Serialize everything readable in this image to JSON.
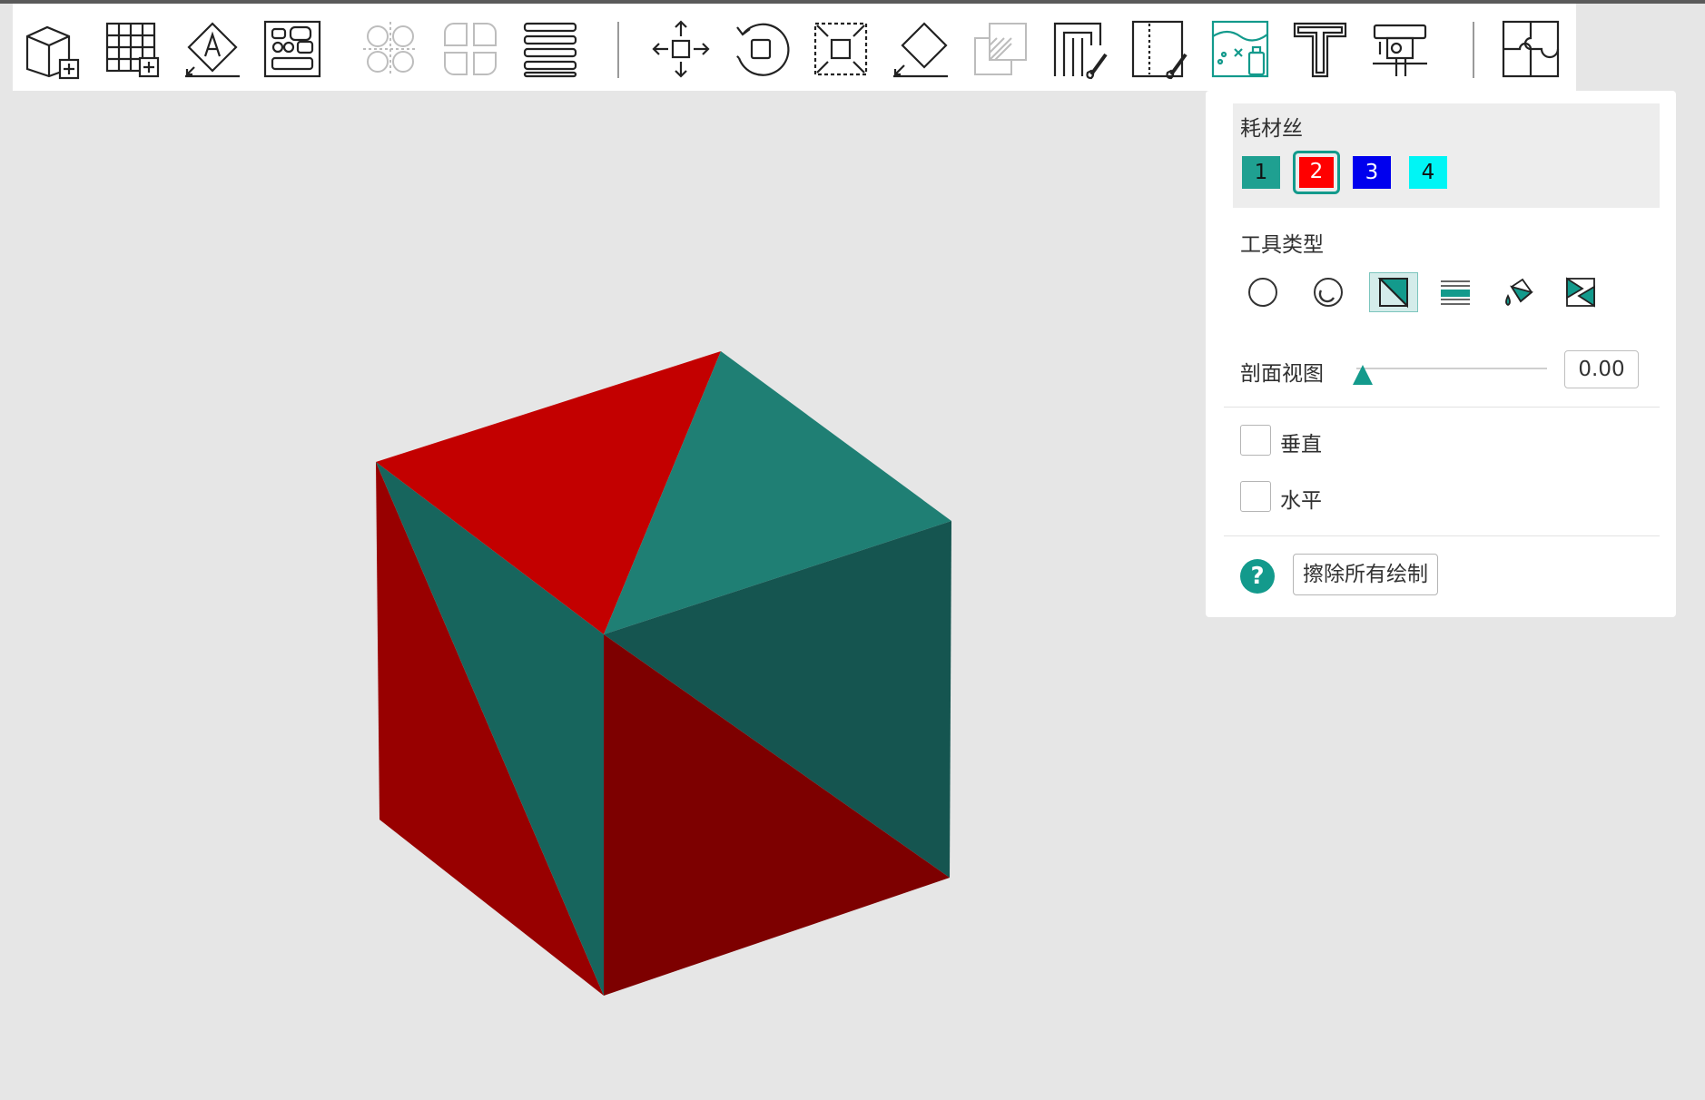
{
  "toolbar": {
    "buttons": [
      {
        "name": "add-model-icon",
        "enabled": true
      },
      {
        "name": "add-grid-plate-icon",
        "enabled": true
      },
      {
        "name": "auto-orient-icon",
        "enabled": true
      },
      {
        "name": "arrange-icon",
        "enabled": true
      },
      {
        "name": "split-objects-icon",
        "enabled": false
      },
      {
        "name": "split-parts-icon",
        "enabled": false
      },
      {
        "name": "layers-icon",
        "enabled": true
      },
      {
        "name": "move-icon",
        "enabled": true
      },
      {
        "name": "rotate-icon",
        "enabled": true
      },
      {
        "name": "scale-icon",
        "enabled": true
      },
      {
        "name": "lay-on-face-icon",
        "enabled": true
      },
      {
        "name": "cut-icon",
        "enabled": false
      },
      {
        "name": "support-paint-icon",
        "enabled": true
      },
      {
        "name": "seam-paint-icon",
        "enabled": true
      },
      {
        "name": "color-paint-icon",
        "enabled": true,
        "active": true
      },
      {
        "name": "text-icon",
        "enabled": true
      },
      {
        "name": "measure-icon",
        "enabled": true
      },
      {
        "name": "assembly-icon",
        "enabled": true
      }
    ]
  },
  "panel": {
    "filament_label": "耗材丝",
    "filaments": [
      {
        "label": "1",
        "color": "#1fa091"
      },
      {
        "label": "2",
        "color": "#ff0000",
        "selected": true
      },
      {
        "label": "3",
        "color": "#0000ee"
      },
      {
        "label": "4",
        "color": "#00f5f5"
      }
    ],
    "tool_type_label": "工具类型",
    "tools": [
      {
        "name": "circle-tool-icon"
      },
      {
        "name": "sphere-tool-icon"
      },
      {
        "name": "triangle-tool-icon",
        "active": true
      },
      {
        "name": "height-range-tool-icon"
      },
      {
        "name": "fill-tool-icon"
      },
      {
        "name": "gap-fill-tool-icon"
      }
    ],
    "section_view_label": "剖面视图",
    "section_view_value": "0.00",
    "vertical_label": "垂直",
    "horizontal_label": "水平",
    "help_glyph": "?",
    "erase_all_label": "擦除所有绘制"
  },
  "colors": {
    "accent": "#139a8c",
    "background": "#e6e6e6"
  }
}
